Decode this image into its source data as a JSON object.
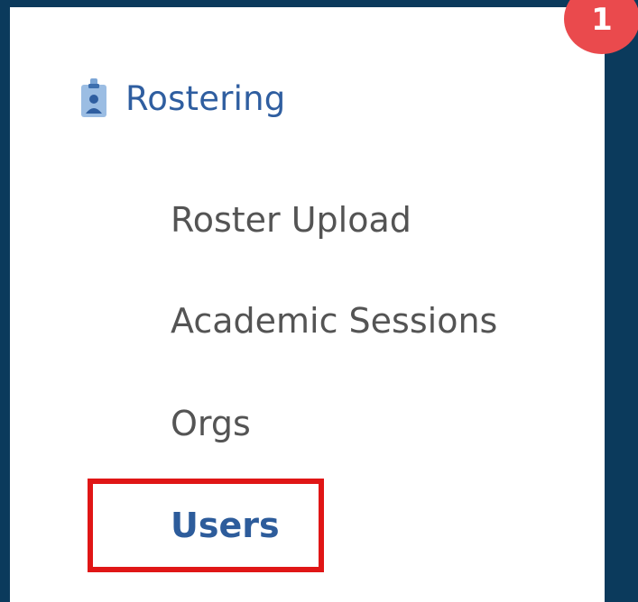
{
  "step_badge": "1",
  "section": {
    "label": "Rostering",
    "icon": "id-badge-icon"
  },
  "nav_items": [
    {
      "label": "Roster Upload"
    },
    {
      "label": "Academic Sessions"
    },
    {
      "label": "Orgs"
    },
    {
      "label": "Users",
      "active": true
    }
  ],
  "colors": {
    "background": "#0b3a5c",
    "panel": "#ffffff",
    "section_label": "#2f5ea0",
    "nav_text": "#545454",
    "active_text": "#2d5c9b",
    "highlight": "#e01616",
    "badge": "#ea4a4d"
  }
}
